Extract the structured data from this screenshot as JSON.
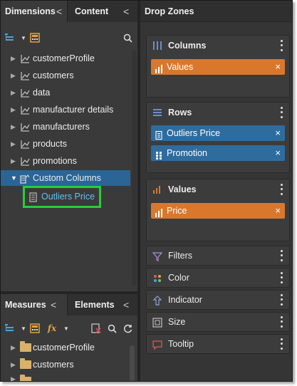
{
  "colors": {
    "accent_blue": "#2e6c9e",
    "accent_orange": "#d9782d",
    "highlight_green": "#22d133",
    "selected_row": "#2a6596",
    "link_blue": "#5fc3f0"
  },
  "top_tabs": {
    "dimensions": "Dimensions",
    "content": "Content",
    "collapse_glyph": "<"
  },
  "tree": {
    "items": [
      {
        "label": "customerProfile",
        "icon": "hierarchy-icon"
      },
      {
        "label": "customers",
        "icon": "hierarchy-icon"
      },
      {
        "label": "data",
        "icon": "hierarchy-icon"
      },
      {
        "label": "manufacturer details",
        "icon": "hierarchy-icon"
      },
      {
        "label": "manufacturers",
        "icon": "hierarchy-icon"
      },
      {
        "label": "products",
        "icon": "hierarchy-icon"
      },
      {
        "label": "promotions",
        "icon": "hierarchy-icon"
      },
      {
        "label": "Custom Columns",
        "icon": "custom-columns-icon",
        "expanded": true,
        "selected": true
      }
    ],
    "child": {
      "label": "Outliers Price",
      "icon": "calculated-column-icon"
    }
  },
  "bottom_tabs": {
    "measures": "Measures",
    "elements": "Elements",
    "collapse_glyph": "<"
  },
  "measures_tree": {
    "items": [
      {
        "label": "customerProfile",
        "icon": "folder-icon"
      },
      {
        "label": "customers",
        "icon": "folder-icon"
      }
    ]
  },
  "drop_zones": {
    "title": "Drop Zones",
    "columns": {
      "title": "Columns",
      "pills": [
        {
          "label": "Values",
          "color": "orange"
        }
      ]
    },
    "rows": {
      "title": "Rows",
      "pills": [
        {
          "label": "Outliers Price",
          "color": "blue"
        },
        {
          "label": "Promotion",
          "color": "blue"
        }
      ]
    },
    "values": {
      "title": "Values",
      "pills": [
        {
          "label": "Price",
          "color": "orange"
        }
      ]
    },
    "filters": "Filters",
    "color": "Color",
    "indicator": "Indicator",
    "size": "Size",
    "tooltip": "Tooltip"
  },
  "glyphs": {
    "close": "×",
    "collapse": "<",
    "fx": "fx"
  }
}
